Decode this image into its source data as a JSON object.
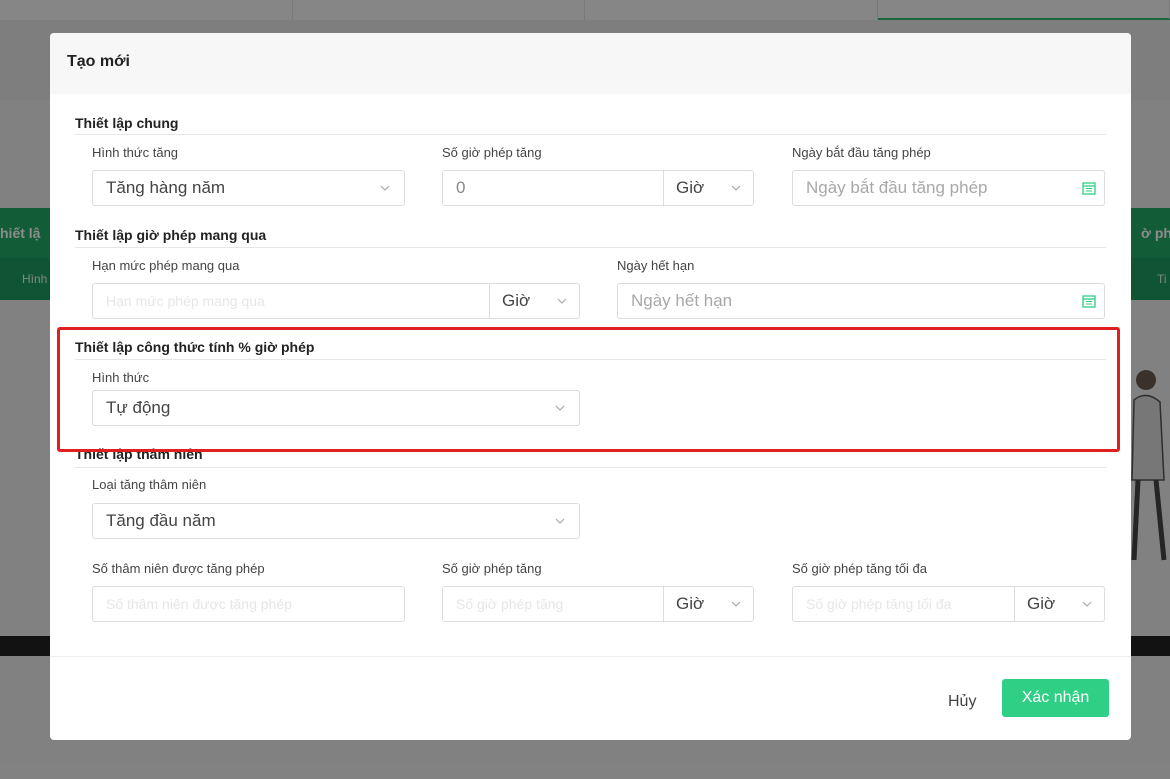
{
  "background": {
    "green_left": "hiết lậ",
    "green_left_sub": "Hình",
    "green_right": "ờ phé",
    "green_right_sub": "Ti"
  },
  "modal": {
    "title": "Tạo mới",
    "general": {
      "title": "Thiết lập chung",
      "increase_type_label": "Hình thức tăng",
      "increase_type_value": "Tăng hàng năm",
      "hours_label": "Số giờ phép tăng",
      "hours_value": "0",
      "hours_unit": "Giờ",
      "start_date_label": "Ngày bắt đầu tăng phép",
      "start_date_placeholder": "Ngày bắt đầu tăng phép"
    },
    "carry": {
      "title": "Thiết lập giờ phép mang qua",
      "limit_label": "Hạn mức phép mang qua",
      "limit_placeholder": "Hạn mức phép mang qua",
      "limit_unit": "Giờ",
      "expiry_label": "Ngày hết hạn",
      "expiry_placeholder": "Ngày hết hạn"
    },
    "formula": {
      "title": "Thiết lập công thức tính % giờ phép",
      "type_label": "Hình thức",
      "type_value": "Tự động"
    },
    "seniority": {
      "title": "Thiết lập thâm niên",
      "type_label": "Loại tăng thâm niên",
      "type_value": "Tăng đầu năm",
      "years_label": "Số thâm niên được tăng phép",
      "years_placeholder": "Số thâm niên được tăng phép",
      "hours_label": "Số giờ phép tăng",
      "hours_placeholder": "Số giờ phép tăng",
      "hours_unit": "Giờ",
      "max_label": "Số giờ phép tăng tối đa",
      "max_placeholder": "Số giờ phép tăng tối đa",
      "max_unit": "Giờ"
    },
    "footer": {
      "cancel_label": "Hủy",
      "confirm_label": "Xác nhận"
    }
  },
  "colors": {
    "accent": "#2fcf86",
    "highlight": "#e02020"
  }
}
